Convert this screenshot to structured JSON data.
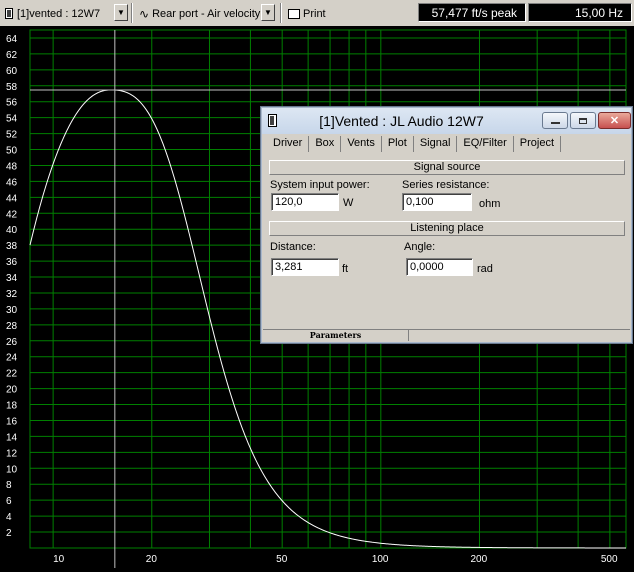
{
  "toolbar": {
    "project_label": "[1]vented : 12W7",
    "project_icon": "document-icon",
    "plot_label": "Rear port - Air velocity",
    "plot_icon": "waveform-icon",
    "print_label": "Print",
    "print_icon": "printer-icon",
    "peak_readout": "57,477 ft/s peak",
    "freq_readout": "15,00 Hz"
  },
  "dialog": {
    "title": "[1]Vented : JL Audio 12W7",
    "window_icon": "document-icon",
    "tabs": [
      "Driver",
      "Box",
      "Vents",
      "Plot",
      "Signal",
      "EQ/Filter",
      "Project"
    ],
    "active_tab": "Signal",
    "signal_source_header": "Signal source",
    "system_input_power_label": "System input power:",
    "system_input_power_value": "120,0",
    "system_input_power_unit": "W",
    "series_resistance_label": "Series resistance:",
    "series_resistance_value": "0,100",
    "series_resistance_unit": "ohm",
    "listening_place_header": "Listening place",
    "distance_label": "Distance:",
    "distance_value": "3,281",
    "distance_unit": "ft",
    "angle_label": "Angle:",
    "angle_value": "0,0000",
    "angle_unit": "rad",
    "status_parameters": "Parameters"
  },
  "plot": {
    "background_color": "#000000",
    "grid_color": "#008000",
    "curve_color": "#ffffff",
    "label_color": "#ffffff",
    "y_ticks": [
      2,
      4,
      6,
      8,
      10,
      12,
      14,
      16,
      18,
      20,
      22,
      24,
      26,
      28,
      30,
      32,
      34,
      36,
      38,
      40,
      42,
      44,
      46,
      48,
      50,
      52,
      54,
      56,
      58,
      60,
      62,
      64
    ],
    "x_ticks": [
      "10",
      "20",
      "50",
      "100",
      "200",
      "500"
    ],
    "cursor_freq_hz": 15,
    "peak_value": 57.477
  }
}
